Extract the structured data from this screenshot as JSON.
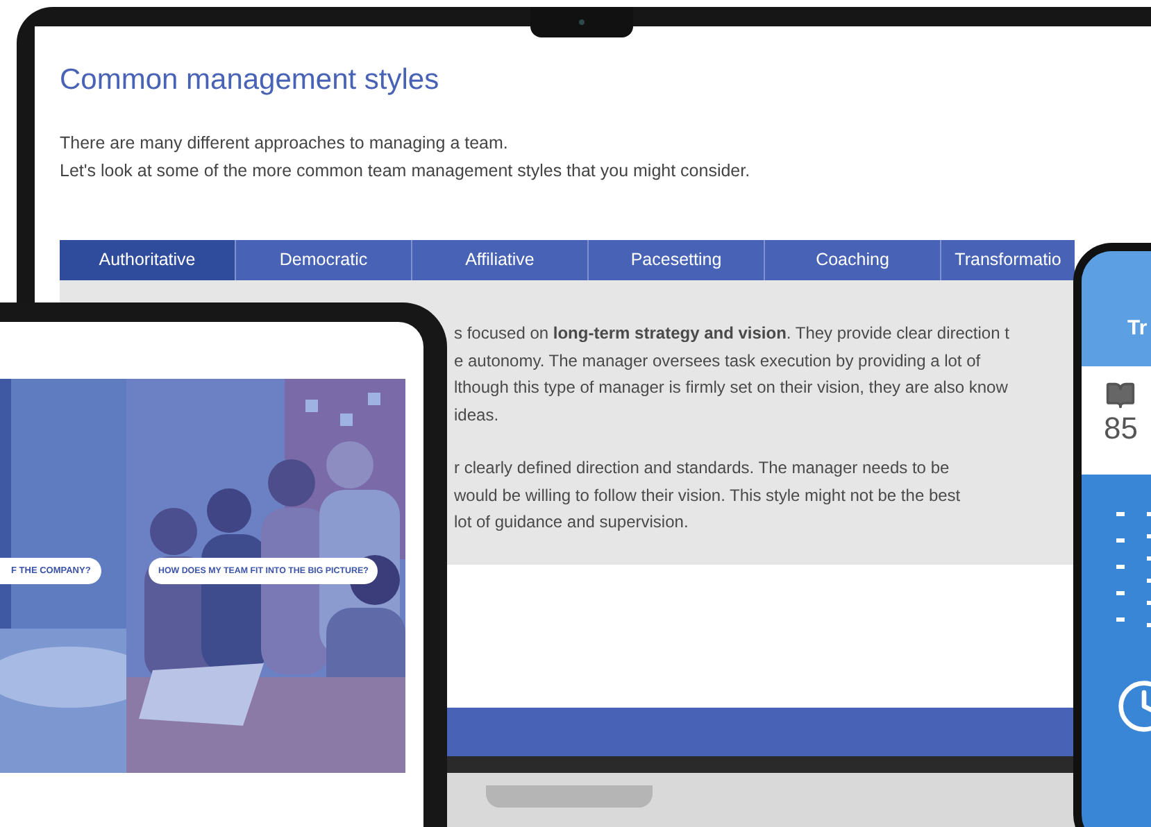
{
  "laptop": {
    "title": "Common management styles",
    "intro": [
      "There are many different approaches to managing a team.",
      "Let's look at some of the more common team management styles that you might consider."
    ],
    "tabs": [
      {
        "label": "Authoritative",
        "selected": true
      },
      {
        "label": "Democratic",
        "selected": false
      },
      {
        "label": "Affiliative",
        "selected": false
      },
      {
        "label": "Pacesetting",
        "selected": false
      },
      {
        "label": "Coaching",
        "selected": false
      },
      {
        "label": "Transformatio",
        "selected": false
      }
    ],
    "paragraphs": [
      [
        "s focused on **long-term strategy and vision**. They provide clear direction t",
        "e autonomy. The manager oversees task execution by providing a lot of",
        "lthough this type of manager is firmly set on their vision, they are also know",
        "ideas."
      ],
      [
        "r clearly defined direction and standards. The manager needs to be",
        "would be willing to follow their vision. This style might not be the best",
        "lot of guidance and supervision."
      ]
    ]
  },
  "tablet": {
    "captions": [
      "F THE COMPANY?",
      "HOW DOES MY TEAM FIT INTO THE BIG PICTURE?"
    ]
  },
  "phone": {
    "title": "Tr",
    "count": "85"
  }
}
